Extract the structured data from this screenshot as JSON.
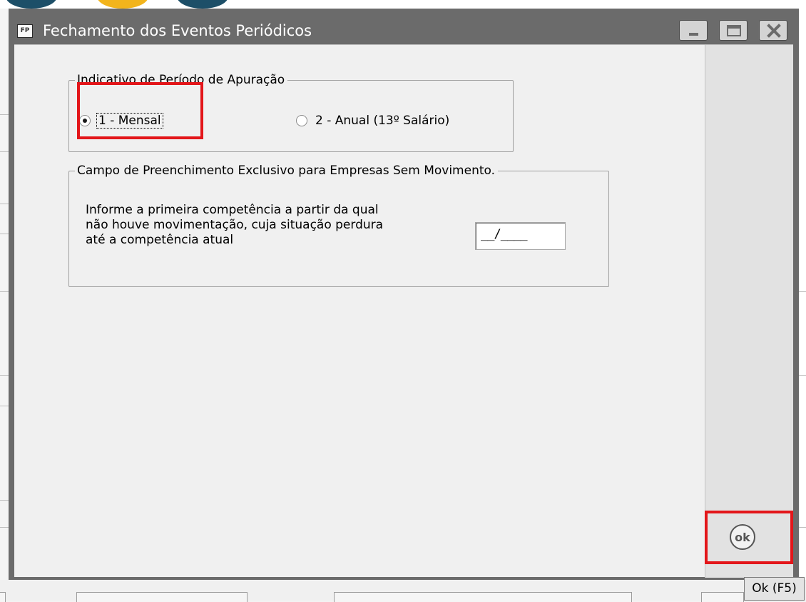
{
  "window": {
    "icon_text": "FP",
    "title": "Fechamento dos Eventos Periódicos",
    "controls": {
      "minimize": "minimize-icon",
      "maximize": "maximize-icon",
      "close": "close-icon"
    }
  },
  "periodo": {
    "legend": "Indicativo de Período de Apuração",
    "options": [
      {
        "label": "1 - Mensal",
        "selected": true
      },
      {
        "label": "2 - Anual (13º Salário)",
        "selected": false
      }
    ]
  },
  "campo": {
    "legend": "Campo de Preenchimento Exclusivo para Empresas Sem Movimento.",
    "instruction_lines": [
      "Informe a primeira competência a partir da  qual",
      "não houve movimentação, cuja situação perdura",
      "até a competência atual"
    ],
    "competencia_value": "__/____"
  },
  "toolbar": {
    "ok_icon": "ok-icon",
    "ok_text": "ok",
    "ok_tooltip": "Ok (F5)"
  },
  "colors": {
    "highlight": "#e3161a",
    "window_frame": "#6b6b6b"
  }
}
